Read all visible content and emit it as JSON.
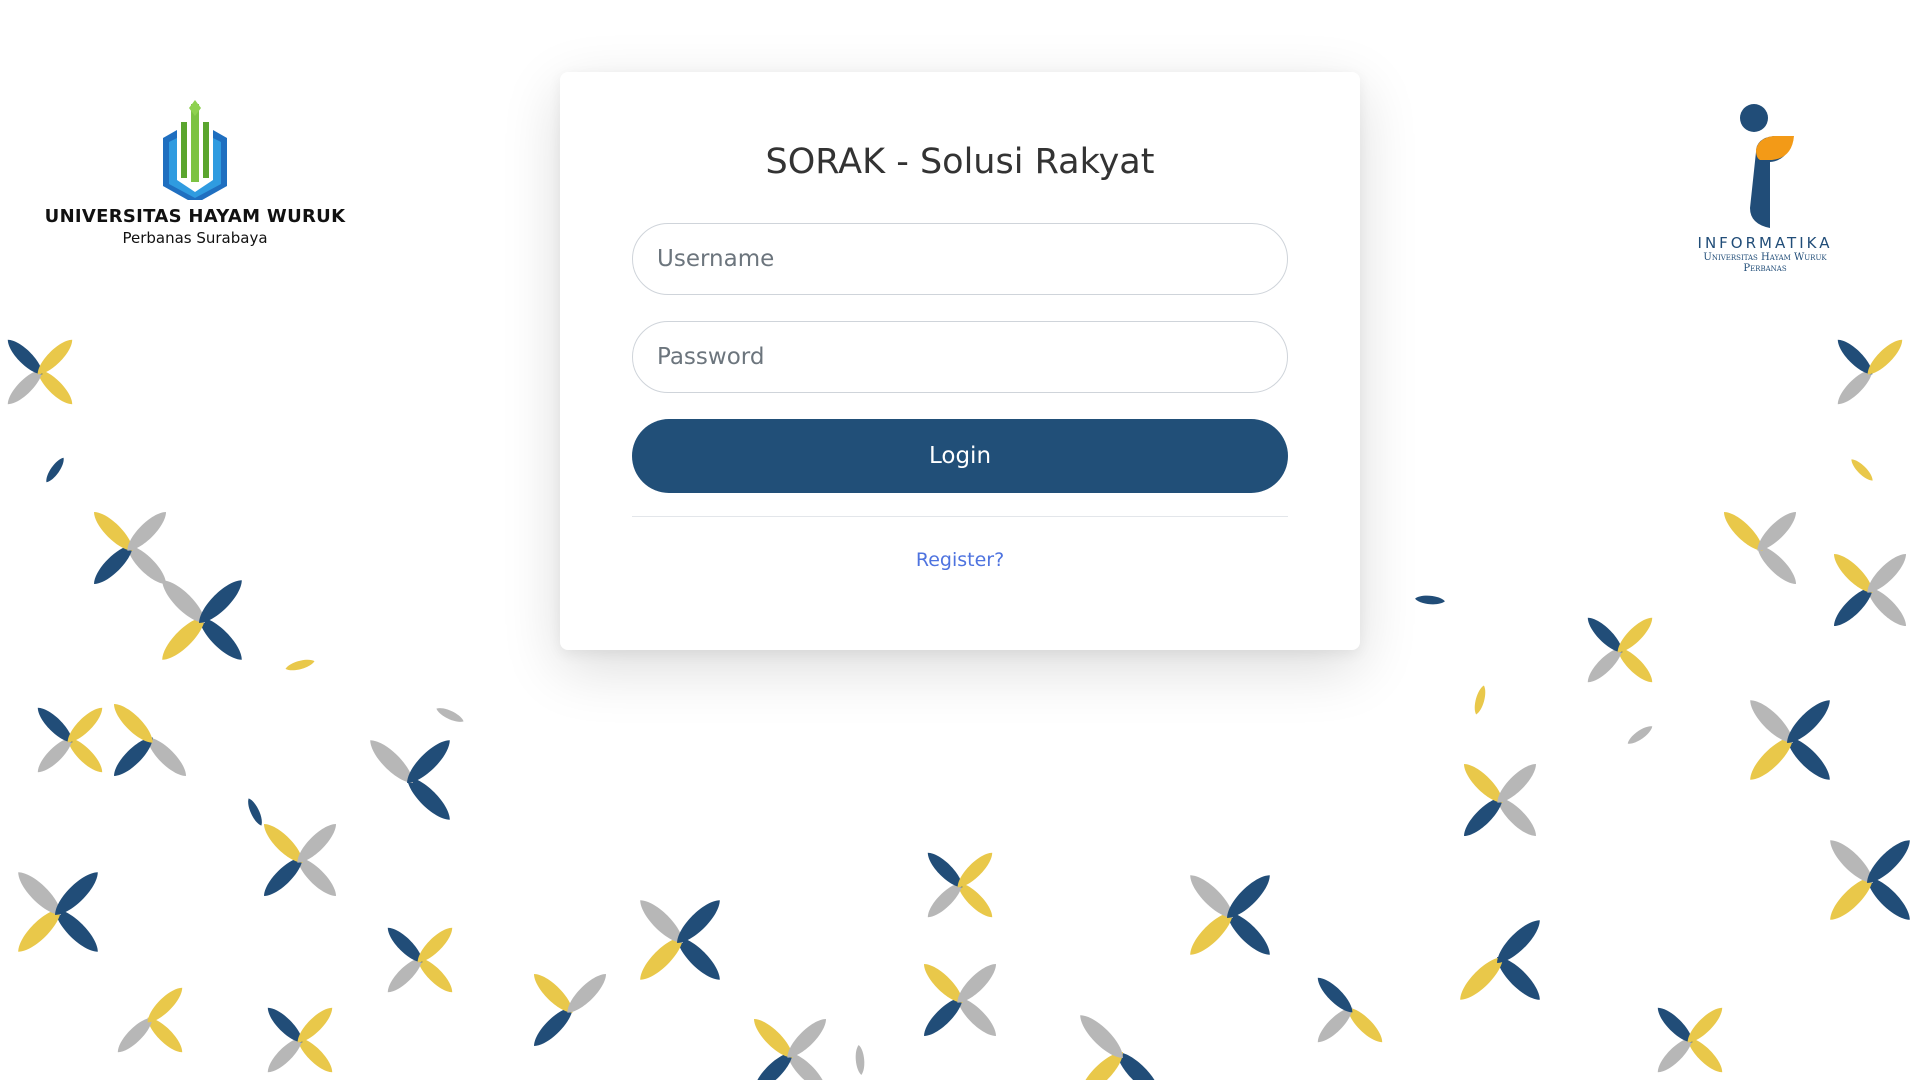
{
  "app": {
    "title": "SORAK - Solusi Rakyat"
  },
  "logos": {
    "left": {
      "name": "UNIVERSITAS HAYAM WURUK",
      "subtitle": "Perbanas Surabaya",
      "icon": "book-sprout-logo"
    },
    "right": {
      "name": "INFORMATIKA",
      "subtitle_line1": "Universitas Hayam Wuruk",
      "subtitle_line2": "Perbanas",
      "icon": "i-figure-logo"
    }
  },
  "form": {
    "username": {
      "placeholder": "Username",
      "value": ""
    },
    "password": {
      "placeholder": "Password",
      "value": ""
    },
    "login_label": "Login",
    "register_label": "Register?"
  },
  "colors": {
    "primary": "#214f78",
    "link": "#4e73df",
    "petal_navy": "#214d78",
    "petal_yellow": "#e9c84a",
    "petal_gray": "#b7b7b7"
  }
}
